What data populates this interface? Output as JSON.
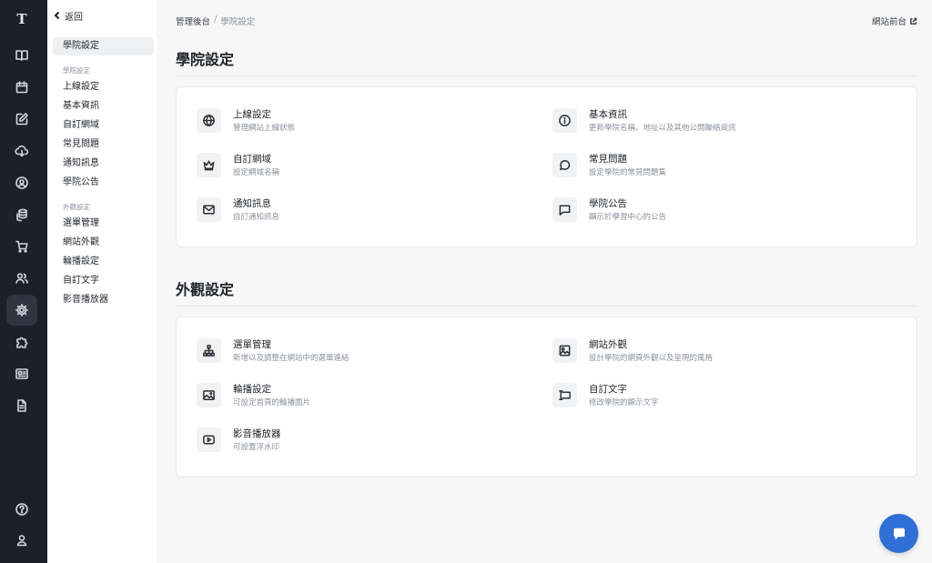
{
  "rail": {
    "logo": "T",
    "icons": [
      "book-icon",
      "calendar-icon",
      "edit-icon",
      "download-icon",
      "user-circle-icon",
      "coins-icon",
      "cart-icon",
      "users-icon",
      "gear-icon",
      "puzzle-icon",
      "layout-icon",
      "document-icon",
      "help-icon",
      "account-icon"
    ],
    "active": "gear-icon"
  },
  "subnav": {
    "back_label": "返回",
    "active_label": "學院設定",
    "groups": [
      {
        "title": "學院設定",
        "items": [
          "上線設定",
          "基本資訊",
          "自訂網域",
          "常見問題",
          "通知訊息",
          "學院公告"
        ]
      },
      {
        "title": "外觀設定",
        "items": [
          "選單管理",
          "網站外觀",
          "輪播設定",
          "自訂文字",
          "影音播放器"
        ]
      }
    ]
  },
  "breadcrumb": {
    "first": "管理後台",
    "separator": "/",
    "current": "學院設定"
  },
  "front_link": "網站前台",
  "sections": [
    {
      "title": "學院設定",
      "items": [
        {
          "icon": "globe-icon",
          "title": "上線設定",
          "desc": "管理網站上線狀態"
        },
        {
          "icon": "info-icon",
          "title": "基本資訊",
          "desc": "更新學院名稱、地址以及其他公開聯絡資訊"
        },
        {
          "icon": "crown-icon",
          "title": "自訂網域",
          "desc": "設定網域名稱"
        },
        {
          "icon": "chat-bubble-icon",
          "title": "常見問題",
          "desc": "設定學院的常見問題集"
        },
        {
          "icon": "mail-icon",
          "title": "通知訊息",
          "desc": "自訂通知訊息"
        },
        {
          "icon": "message-square-icon",
          "title": "學院公告",
          "desc": "顯示於學習中心的公告"
        }
      ]
    },
    {
      "title": "外觀設定",
      "items": [
        {
          "icon": "sitemap-icon",
          "title": "選單管理",
          "desc": "新增以及調整在網站中的選單連結"
        },
        {
          "icon": "image-icon",
          "title": "網站外觀",
          "desc": "設計學院的網頁外觀以及呈現的風格"
        },
        {
          "icon": "picture-icon",
          "title": "輪播設定",
          "desc": "可設定首頁的輪播圖片"
        },
        {
          "icon": "text-cursor-icon",
          "title": "自訂文字",
          "desc": "修改學院的顯示文字"
        },
        {
          "icon": "video-play-icon",
          "title": "影音播放器",
          "desc": "可設置浮水印"
        }
      ]
    }
  ],
  "colors": {
    "rail_bg": "#1b2029",
    "accent": "#2f6fd6"
  }
}
